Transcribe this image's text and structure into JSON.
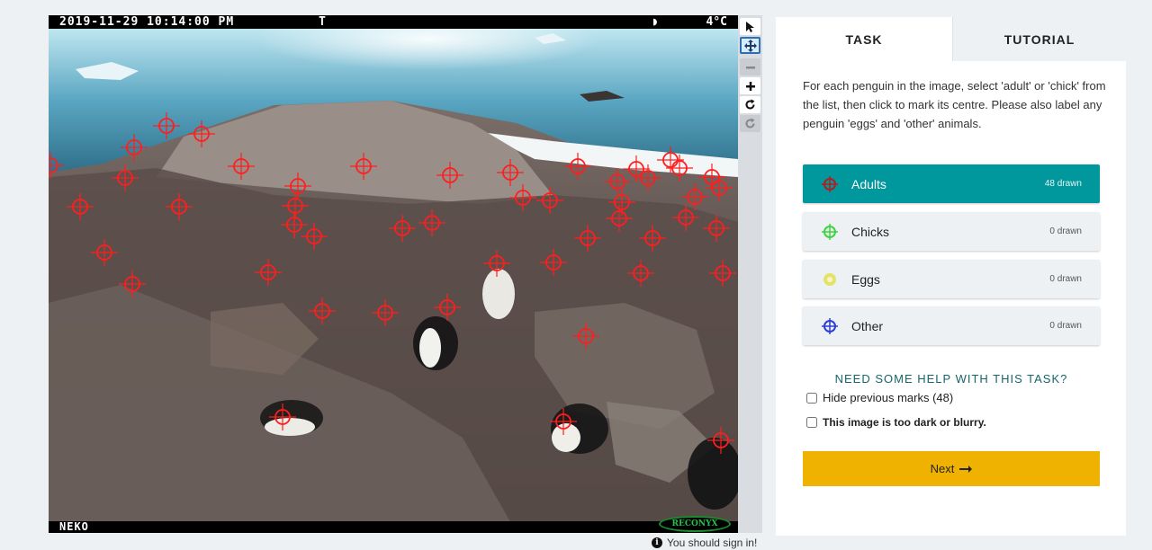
{
  "viewer": {
    "timestamp": "2019-11-29 10:14:00 PM",
    "trigger": "T",
    "moon_glyph": "◗",
    "temperature": "4°C",
    "camera_name": "NEKO",
    "brand": "RECONYX",
    "marker_color": "#ff1e1e"
  },
  "toolbar": {
    "pointer_icon": "pointer-icon",
    "move_icon": "move-icon",
    "zoom_out_icon": "zoom-out-icon",
    "zoom_in_icon": "zoom-in-icon",
    "rotate_icon": "rotate-icon",
    "reset_icon": "reset-icon"
  },
  "signin": {
    "text": "You should sign in!"
  },
  "tabs": {
    "task": "TASK",
    "tutorial": "TUTORIAL"
  },
  "task": {
    "instructions": "For each penguin in the image, select 'adult' or 'chick' from the list, then click to mark its centre. Please also label any penguin 'eggs' and 'other' animals.",
    "choices": [
      {
        "label": "Adults",
        "count": "48 drawn",
        "color": "#b01f1f"
      },
      {
        "label": "Chicks",
        "count": "0 drawn",
        "color": "#3dd33d"
      },
      {
        "label": "Eggs",
        "count": "0 drawn",
        "color": "#e3e36a"
      },
      {
        "label": "Other",
        "count": "0 drawn",
        "color": "#2c3fd6"
      }
    ],
    "help_text": "NEED SOME HELP WITH THIS TASK?",
    "hide_marks_label": "Hide previous marks (48)",
    "dark_label": "This image is too dark or blurry.",
    "next_label": "Next",
    "accent_color": "#00979d",
    "next_color": "#f0b200"
  }
}
